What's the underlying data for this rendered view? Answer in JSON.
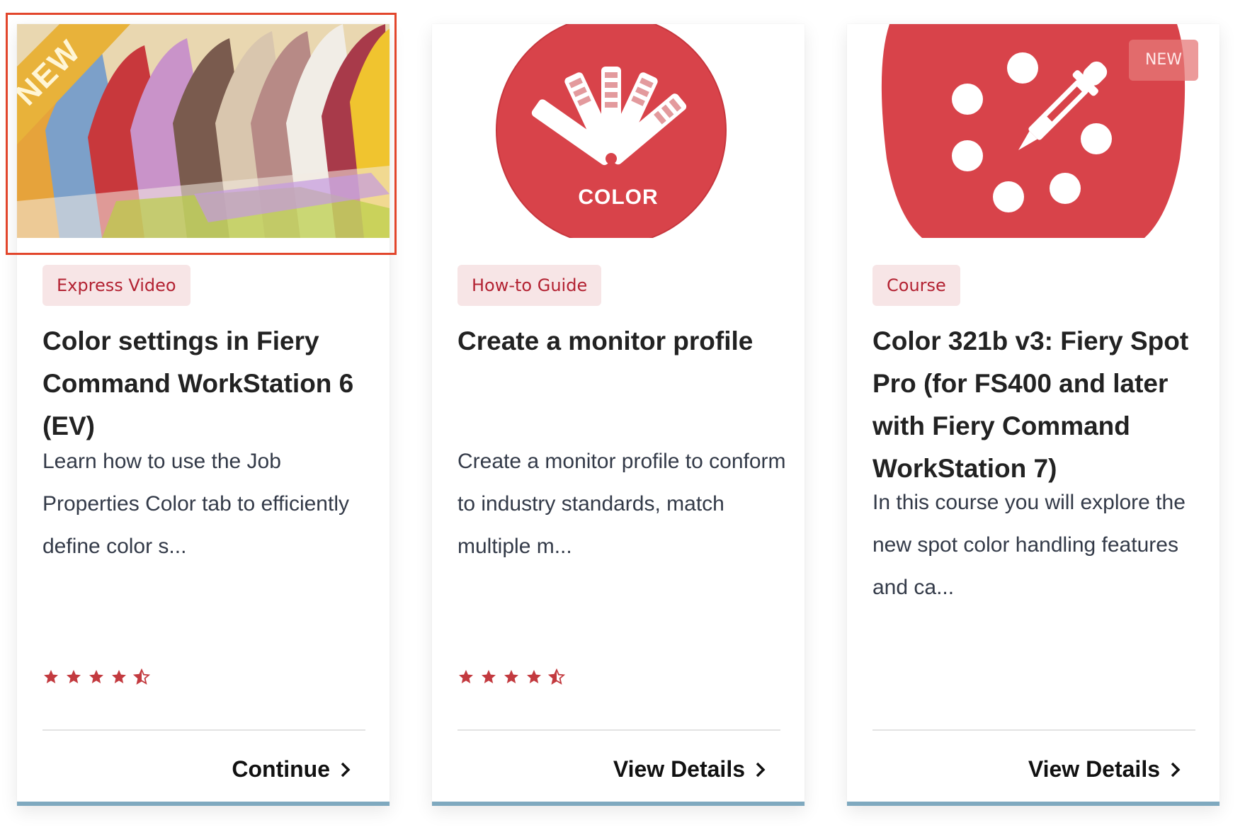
{
  "cards": [
    {
      "tag": "Express Video",
      "title": "Color settings in Fiery Command WorkStation 6 (EV)",
      "description": "Learn how to use the Job Properties Color tab to efficiently define color s...",
      "rating": 4.5,
      "cta": "Continue",
      "ribbon": "NEW",
      "highlighted": true
    },
    {
      "tag": "How-to Guide",
      "title": "Create a monitor profile",
      "description": "Create a monitor profile to conform to industry standards, match multiple m...",
      "rating": 4.5,
      "cta": "View Details",
      "media_label": "COLOR"
    },
    {
      "tag": "Course",
      "title": "Color 321b v3: Fiery Spot Pro (for FS400 and later with Fiery Command WorkStation 7)",
      "description": "In this course you will explore the new spot color handling features and ca...",
      "cta": "View Details",
      "badge": "NEW"
    }
  ],
  "colors": {
    "accent_red": "#d9403f",
    "tag_bg": "#f7e5e6",
    "tag_text": "#b32232",
    "highlight": "#e2462c",
    "ribbon": "#e8b23a"
  },
  "icons": [
    "star-icon",
    "half-star-icon",
    "chevron-right-icon",
    "swatch-fan-icon",
    "eyedropper-icon"
  ]
}
